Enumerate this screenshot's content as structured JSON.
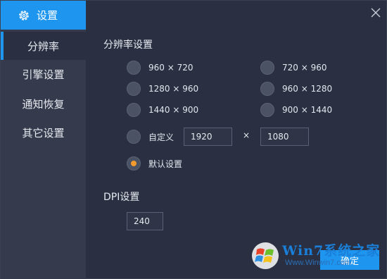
{
  "sidebar": {
    "brand_label": "设置",
    "items": [
      {
        "label": "分辨率"
      },
      {
        "label": "引擎设置"
      },
      {
        "label": "通知恢复"
      },
      {
        "label": "其它设置"
      }
    ]
  },
  "resolution": {
    "title": "分辨率设置",
    "options": [
      {
        "label": "960 × 720"
      },
      {
        "label": "720 × 960"
      },
      {
        "label": "1280 × 960"
      },
      {
        "label": "960 × 1280"
      },
      {
        "label": "1440 × 900"
      },
      {
        "label": "900 × 1440"
      }
    ],
    "custom_label": "自定义",
    "custom_width": "1920",
    "times_sign": "×",
    "custom_height": "1080",
    "default_label": "默认设置",
    "selected": "默认设置"
  },
  "dpi": {
    "title": "DPI设置",
    "value": "240"
  },
  "footer": {
    "ok_label": "确定"
  },
  "watermark": {
    "text": "Win7系统之家",
    "url": "Www.Winwin7.com"
  },
  "colors": {
    "accent": "#1e96f0",
    "selected_dot": "#f29a2e"
  }
}
